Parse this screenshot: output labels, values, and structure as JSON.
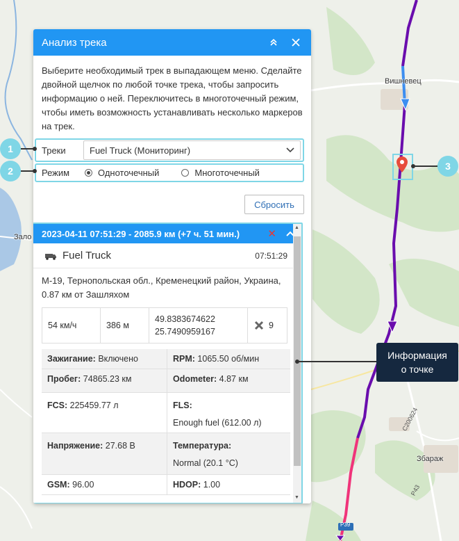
{
  "map": {
    "labels": [
      "Вишневец",
      "Зало",
      "Збараж"
    ],
    "roads": [
      "Р39",
      "С200624",
      "Р43"
    ],
    "colors": {
      "track_purple": "#6a0dad",
      "track_blue": "#3d8ef0",
      "track_pink": "#f0347a"
    }
  },
  "panel": {
    "title": "Анализ трека",
    "description": "Выберите необходимый трек в выпадающем меню. Сделайте двойной щелчок по любой точке трека, чтобы запросить информацию о ней. Переключитесь в многоточечный режим, чтобы иметь возможность устанавливать несколько маркеров на трек.",
    "tracks_label": "Треки",
    "tracks_value": "Fuel Truck (Мониторинг)",
    "mode_label": "Режим",
    "mode_single": "Одноточечный",
    "mode_multi": "Многоточечный",
    "reset": "Сбросить"
  },
  "info": {
    "header": "2023-04-11 07:51:29 - 2085.9 км (+7 ч. 51 мин.)",
    "unit_name": "Fuel Truck",
    "unit_time": "07:51:29",
    "address": "М-19, Тернопольская обл., Кременецкий район, Украина, 0.87 км от Зашляхом",
    "speed": "54 км/ч",
    "altitude": "386 м",
    "lat": "49.8383674622",
    "lon": "25.7490959167",
    "satellites": "9",
    "params": [
      {
        "label": "Зажигание:",
        "value": " Включено"
      },
      {
        "label": "RPM:",
        "value": " 1065.50 об/мин"
      },
      {
        "label": "Пробег:",
        "value": " 74865.23 км"
      },
      {
        "label": "Odometer:",
        "value": " 4.87 км"
      },
      {
        "label": "FCS:",
        "value": " 225459.77 л"
      },
      {
        "label": "FLS:",
        "value": "Enough fuel (612.00 л)"
      },
      {
        "label": "Напряжение:",
        "value": " 27.68 В"
      },
      {
        "label": "Температура:",
        "value": "Normal (20.1 °C)"
      },
      {
        "label": "GSM:",
        "value": " 96.00"
      },
      {
        "label": "HDOP:",
        "value": " 1.00"
      }
    ]
  },
  "callouts": {
    "n1": "1",
    "n2": "2",
    "n3": "3",
    "tooltip_l1": "Информация",
    "tooltip_l2": "о точке"
  }
}
